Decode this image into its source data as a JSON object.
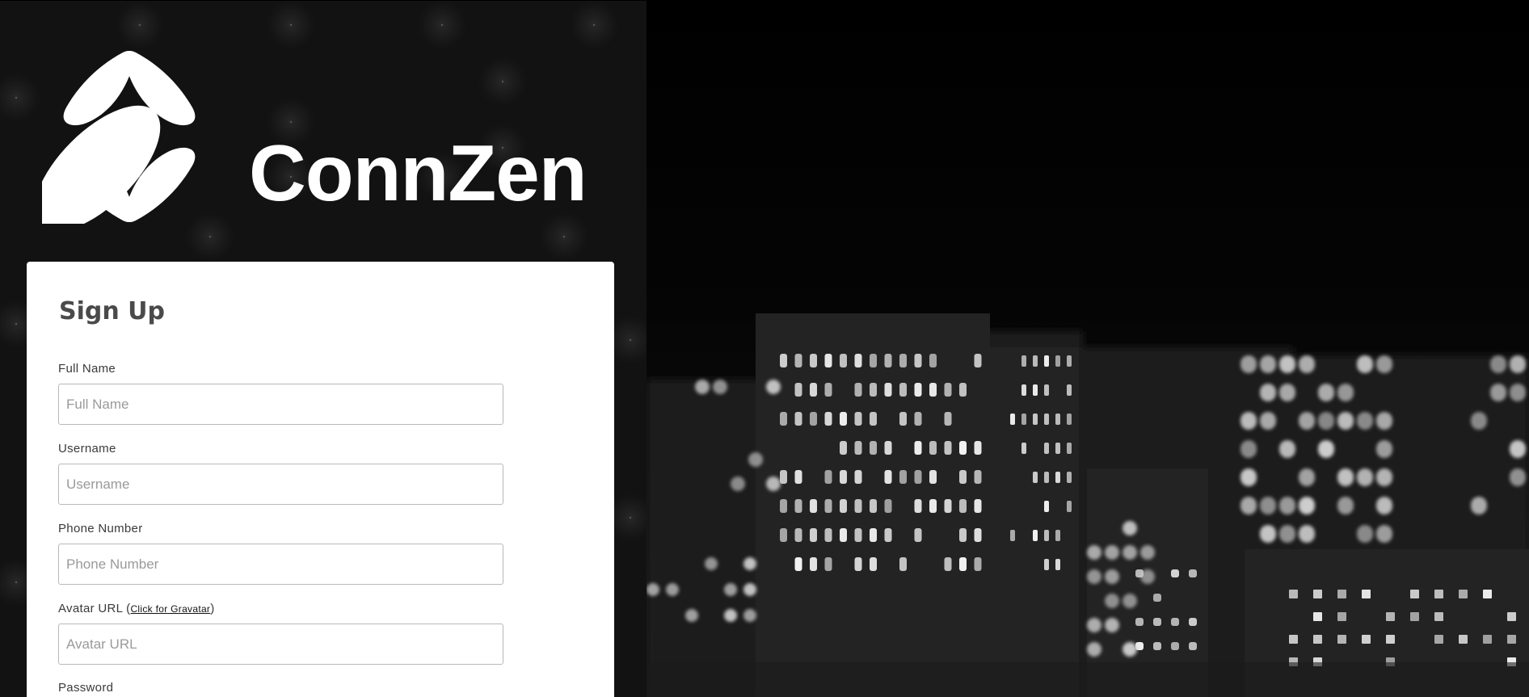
{
  "brand": {
    "name": "ConnZen",
    "logo_icon": "four-petal-diamond-logo"
  },
  "signup": {
    "title": "Sign Up",
    "fields": {
      "full_name": {
        "label": "Full Name",
        "placeholder": "Full Name",
        "value": ""
      },
      "username": {
        "label": "Username",
        "placeholder": "Username",
        "value": ""
      },
      "phone": {
        "label": "Phone Number",
        "placeholder": "Phone Number",
        "value": ""
      },
      "avatar": {
        "label": "Avatar URL (",
        "link_text": "Click for Gravatar",
        "label_suffix": ")",
        "placeholder": "Avatar URL",
        "value": ""
      },
      "password": {
        "label": "Password"
      }
    }
  },
  "hero": {
    "image": "blurred-night-city-skyline-grayscale"
  },
  "colors": {
    "left_panel_bg": "#121212",
    "card_bg": "#ffffff",
    "title_text": "#4a4a4a",
    "hero_bg": "#000000"
  }
}
